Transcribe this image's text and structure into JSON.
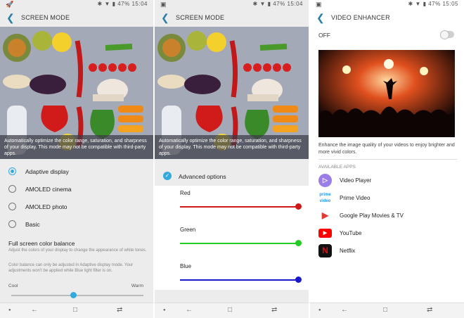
{
  "status": {
    "left_icon": "rocket-notification-icon",
    "panel1": {
      "battery": "47%",
      "time": "15:04"
    },
    "panel2": {
      "battery": "47%",
      "time": "15:04"
    },
    "panel3": {
      "battery": "47%",
      "time": "15:05"
    }
  },
  "screen_mode": {
    "title": "SCREEN MODE",
    "caption": "Automatically optimize the color range, saturation, and sharpness of your display. This mode may not be compatible with third-party apps.",
    "options": [
      {
        "label": "Adaptive display",
        "selected": true
      },
      {
        "label": "AMOLED cinema",
        "selected": false
      },
      {
        "label": "AMOLED photo",
        "selected": false
      },
      {
        "label": "Basic",
        "selected": false
      }
    ],
    "balance_title": "Full screen color balance",
    "balance_desc": "Adjust the colors of your display to change the appearance of white tones.",
    "balance_note": "Color balance can only be adjusted in Adaptive display mode. Your adjustments won't be applied while Blue light filter is on.",
    "cool_label": "Cool",
    "warm_label": "Warm",
    "balance_value": 0.47
  },
  "advanced": {
    "title": "SCREEN MODE",
    "caption": "Automatically optimize the color range, saturation, and sharpness of your display. This mode may not be compatible with third-party apps.",
    "checkbox_label": "Advanced options",
    "checked": true,
    "sliders": [
      {
        "label": "Red",
        "color": "#d01818",
        "value": 1.0
      },
      {
        "label": "Green",
        "color": "#22cc22",
        "value": 1.0
      },
      {
        "label": "Blue",
        "color": "#1818cc",
        "value": 1.0
      }
    ]
  },
  "video_enhancer": {
    "title": "VIDEO ENHANCER",
    "toggle_label": "OFF",
    "toggle_on": false,
    "description": "Enhance the image quality of your videos to enjoy brighter and more vivid colors.",
    "available_label": "AVAILABLE APPS",
    "apps": [
      {
        "name": "Video Player",
        "icon": "video-player-icon",
        "color": "#9b7de8"
      },
      {
        "name": "Prime Video",
        "icon": "prime-video-icon",
        "color": "#1a98ff"
      },
      {
        "name": "Google Play Movies & TV",
        "icon": "play-movies-icon",
        "color": "#e53935"
      },
      {
        "name": "YouTube",
        "icon": "youtube-icon",
        "color": "#ff0000"
      },
      {
        "name": "Netflix",
        "icon": "netflix-icon",
        "color": "#e50914"
      }
    ]
  },
  "colors": {
    "accent": "#33aadd",
    "back_arrow": "#2a7fa8"
  }
}
